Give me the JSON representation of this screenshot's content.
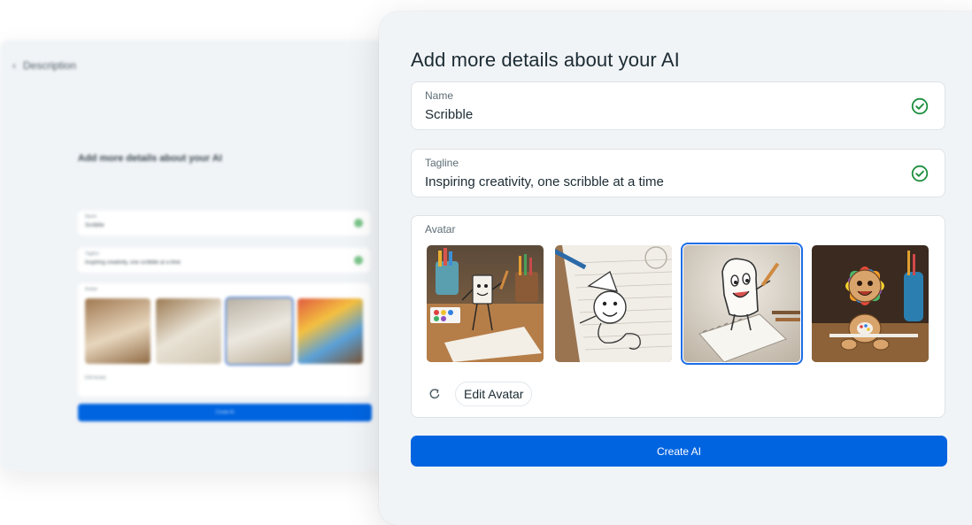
{
  "background_window": {
    "header": "Description",
    "title": "Add more details about your AI",
    "name_label": "Name",
    "name_value": "Scribble",
    "tagline_label": "Tagline",
    "tagline_value": "Inspiring creativity, one scribble at a time",
    "avatar_label": "Avatar",
    "edit_label": "Edit Avatar",
    "create_label": "Create AI"
  },
  "form": {
    "title": "Add more details about your AI",
    "name": {
      "label": "Name",
      "value": "Scribble",
      "valid": true
    },
    "tagline": {
      "label": "Tagline",
      "value": "Inspiring creativity, one scribble at a time",
      "valid": true
    },
    "avatar": {
      "label": "Avatar",
      "selected_index": 2,
      "options": [
        {
          "icon": "scribble-avatar-1"
        },
        {
          "icon": "scribble-avatar-2"
        },
        {
          "icon": "scribble-avatar-3"
        },
        {
          "icon": "scribble-avatar-4"
        }
      ],
      "edit_label": "Edit Avatar"
    },
    "create_label": "Create AI"
  },
  "colors": {
    "primary": "#0064e0",
    "success": "#1e8e3e",
    "selected_outline": "#1e6ee8"
  }
}
